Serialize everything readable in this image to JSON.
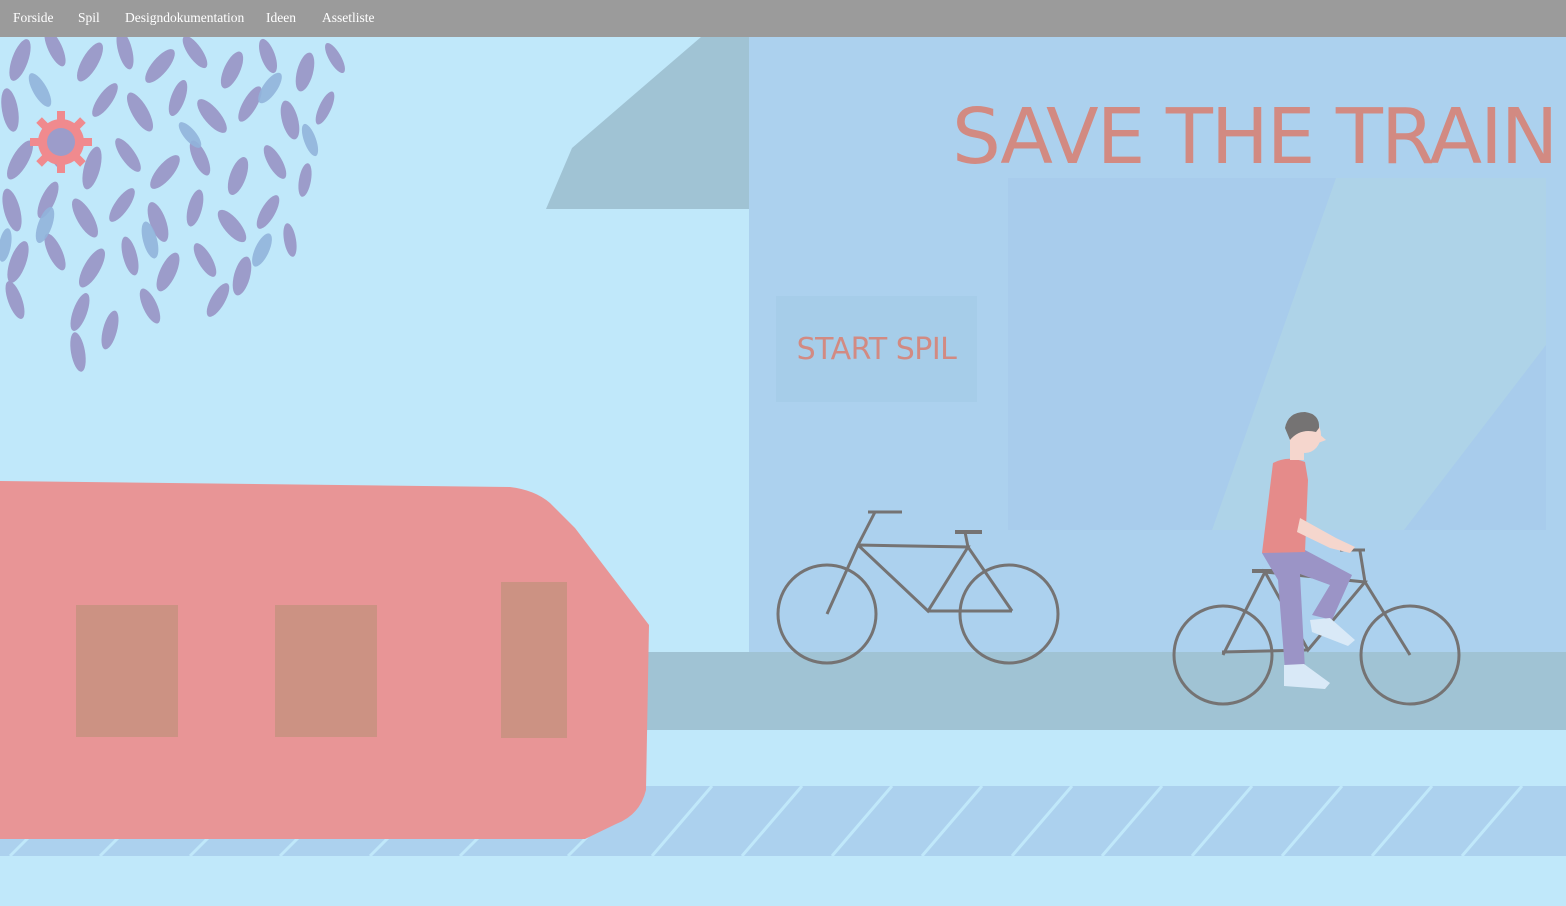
{
  "nav": {
    "items": [
      "Forside",
      "Spil",
      "Designdokumentation",
      "Ideen",
      "Assetliste"
    ]
  },
  "game": {
    "title": "SAVE THE TRAIN",
    "start_label": "START SPIL"
  },
  "icons": {
    "settings": "gear-icon"
  },
  "colors": {
    "nav_bg": "#9b9b9b",
    "sky": "#c0e8fa",
    "building": "#acd1ee",
    "train": "#e89596",
    "accent_text": "#d28a82",
    "leaves": "#9c9cca",
    "bike": "#757373"
  }
}
